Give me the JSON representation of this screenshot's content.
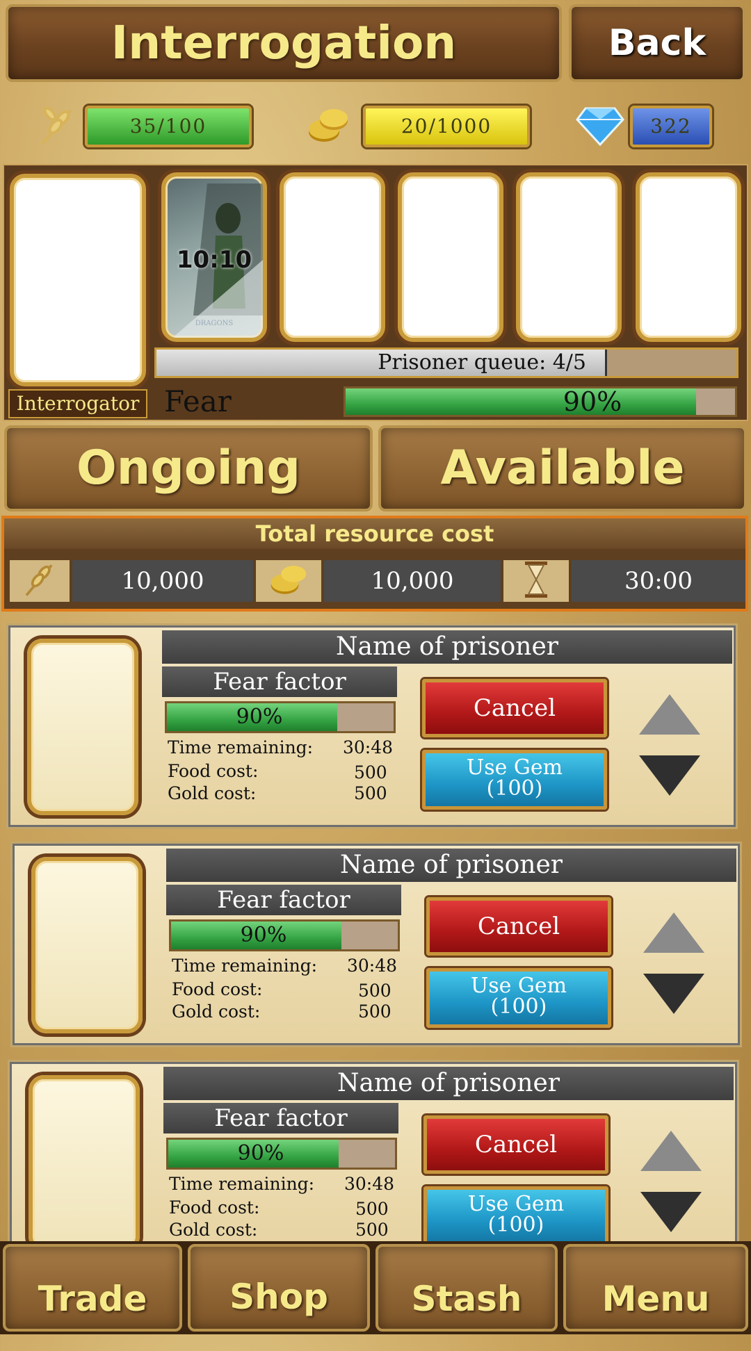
{
  "header": {
    "title": "Interrogation",
    "back_label": "Back"
  },
  "resources": {
    "food": {
      "icon": "wheat-icon",
      "value": "35/100",
      "color": "#3fb33a"
    },
    "gold": {
      "icon": "coins-icon",
      "value": "20/1000",
      "color": "#f2e01e"
    },
    "gems": {
      "icon": "diamond-icon",
      "value": "322",
      "color": "#3a63c9"
    }
  },
  "interrogator": {
    "label": "Interrogator"
  },
  "queue_slot": {
    "timer": "10:10",
    "card_caption": "DRAGONS"
  },
  "prisoner_queue": {
    "label": "Prisoner queue: 4/5"
  },
  "fear": {
    "label": "Fear factor:",
    "value": "90%",
    "fraction": 0.9
  },
  "tabs": {
    "ongoing": "Ongoing",
    "available": "Available"
  },
  "cost": {
    "title": "Total resource cost",
    "food": "10,000",
    "gold": "10,000",
    "time": "30:00"
  },
  "prisoners": [
    {
      "name": "Name of prisoner",
      "fear_label": "Fear factor",
      "fear_value": "90%",
      "time_label": "Time remaining:",
      "time_value": "30:48",
      "food_label": "Food cost:",
      "food_value": "500",
      "gold_label": "Gold cost:",
      "gold_value": "500",
      "cancel": "Cancel",
      "gem_line1": "Use Gem",
      "gem_line2": "(100)"
    },
    {
      "name": "Name of prisoner",
      "fear_label": "Fear factor",
      "fear_value": "90%",
      "time_label": "Time remaining:",
      "time_value": "30:48",
      "food_label": "Food cost:",
      "food_value": "500",
      "gold_label": "Gold cost:",
      "gold_value": "500",
      "cancel": "Cancel",
      "gem_line1": "Use Gem",
      "gem_line2": "(100)"
    },
    {
      "name": "Name of prisoner",
      "fear_label": "Fear factor",
      "fear_value": "90%",
      "time_label": "Time remaining:",
      "time_value": "30:48",
      "food_label": "Food cost:",
      "food_value": "500",
      "gold_label": "Gold cost:",
      "gold_value": "500",
      "cancel": "Cancel",
      "gem_line1": "Use Gem",
      "gem_line2": "(100)"
    }
  ],
  "nav": {
    "trade": "Trade",
    "shop": "Shop",
    "stash": "Stash",
    "menu": "Menu"
  }
}
